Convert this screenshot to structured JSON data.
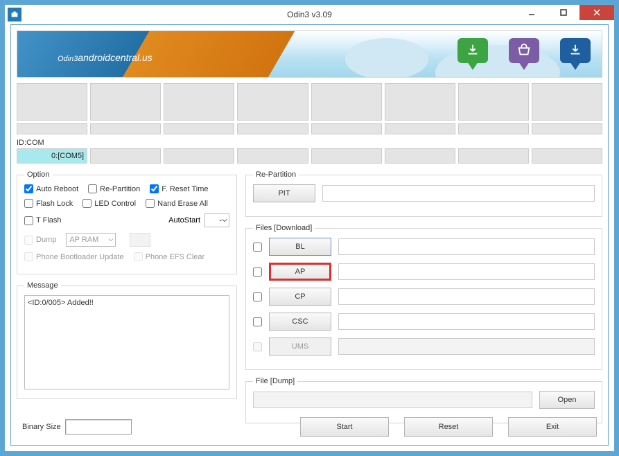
{
  "window": {
    "title": "Odin3 v3.09"
  },
  "banner": {
    "logo_main": "Odin3",
    "logo_sub": "androidcentral.us"
  },
  "idcom": {
    "label": "ID:COM",
    "value": "0:[COM5]"
  },
  "option": {
    "legend": "Option",
    "auto_reboot": "Auto Reboot",
    "re_partition": "Re-Partition",
    "f_reset_time": "F. Reset Time",
    "flash_lock": "Flash Lock",
    "led_control": "LED Control",
    "nand_erase_all": "Nand Erase All",
    "t_flash": "T Flash",
    "autostart_label": "AutoStart",
    "autostart_value": "-",
    "dump": "Dump",
    "dump_select": "AP RAM",
    "phone_bootloader": "Phone Bootloader Update",
    "phone_efs": "Phone EFS Clear"
  },
  "message": {
    "legend": "Message",
    "text": "<ID:0/005> Added!!"
  },
  "repartition": {
    "legend": "Re-Partition",
    "pit": "PIT"
  },
  "files": {
    "legend": "Files [Download]",
    "bl": "BL",
    "ap": "AP",
    "cp": "CP",
    "csc": "CSC",
    "ums": "UMS"
  },
  "filedump": {
    "legend": "File [Dump]",
    "open": "Open"
  },
  "binary": {
    "label": "Binary Size"
  },
  "buttons": {
    "start": "Start",
    "reset": "Reset",
    "exit": "Exit"
  }
}
